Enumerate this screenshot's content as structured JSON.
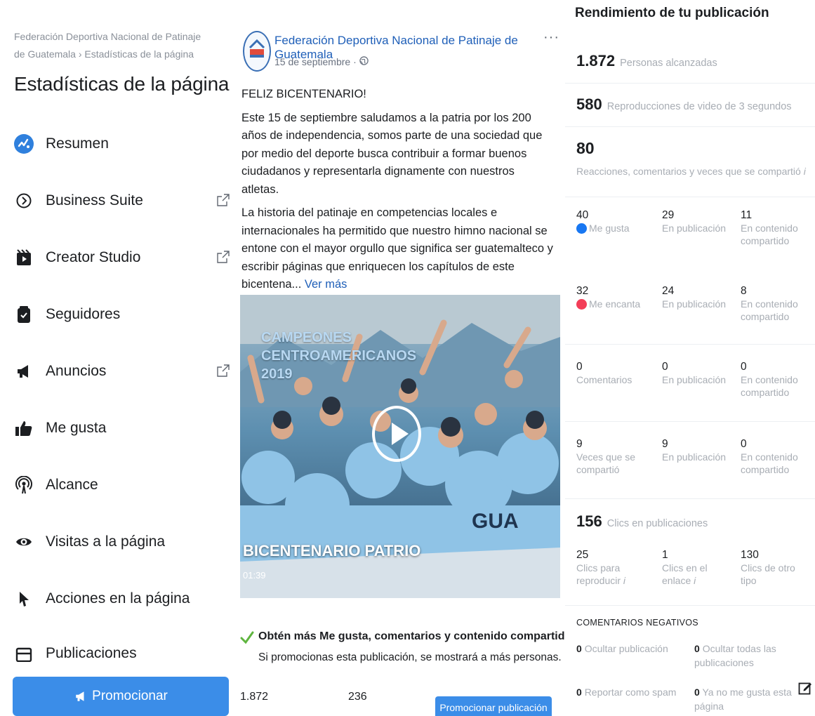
{
  "sidebar": {
    "breadcrumb": "Federación Deportiva Nacional de Patinaje de Guatemala › Estadísticas de la página",
    "title": "Estadísticas de la página",
    "items": [
      {
        "label": "Resumen",
        "icon": "summary-icon"
      },
      {
        "label": "Business Suite",
        "icon": "business-suite-icon"
      },
      {
        "label": "Creator Studio",
        "icon": "creator-studio-icon"
      },
      {
        "label": "Seguidores",
        "icon": "followers-icon"
      },
      {
        "label": "Anuncios",
        "icon": "megaphone-icon"
      },
      {
        "label": "Me gusta",
        "icon": "thumbs-up-icon"
      },
      {
        "label": "Alcance",
        "icon": "reach-icon"
      },
      {
        "label": "Visitas a la página",
        "icon": "eye-icon"
      },
      {
        "label": "Acciones en la página",
        "icon": "cursor-icon"
      },
      {
        "label": "Publicaciones",
        "icon": "posts-icon"
      }
    ],
    "promote_label": "Promocionar"
  },
  "post": {
    "author": "Federación Deportiva Nacional de Patinaje de Guatemala",
    "date": "15 de septiembre ·",
    "more": "···",
    "heading": "FELIZ BICENTENARIO!",
    "paragraph1": "Este 15 de septiembre saludamos a la patria por los 200 años de independencia, somos parte de una sociedad que por medio del deporte busca contribuir a formar buenos ciudadanos y representarla dignamente con nuestros atletas.",
    "paragraph2": "La historia del patinaje en competencias locales e internacionales ha permitido que nuestro himno nacional se entone con el mayor orgullo que significa ser guatemalteco y escribir páginas que enriquecen los capítulos de este bicentena...",
    "see_more": "Ver más",
    "video": {
      "overlay_title": "CAMPEONES CENTROAMERICANOS 2019",
      "title": "BICENTENARIO PATRIO",
      "duration": "01:39"
    },
    "promo_heading": "Obtén más Me gusta, comentarios y contenido compartido",
    "promo_sub": "Si promocionas esta publicación, se mostrará a más personas.",
    "reach": "1.872",
    "engagement": "236",
    "boost_label": "Promocionar publicación"
  },
  "performance": {
    "title": "Rendimiento de tu publicación",
    "people_reached": {
      "value": "1.872",
      "label": "Personas alcanzadas"
    },
    "video_views": {
      "value": "580",
      "label": "Reproducciones de video de 3 segundos"
    },
    "interactions": {
      "value": "80",
      "label": "Reacciones, comentarios y veces que se compartió"
    },
    "rows": [
      {
        "total": "40",
        "total_label": "Me gusta",
        "on_post": "29",
        "on_post_label": "En publicación",
        "shared": "11",
        "shared_label": "En contenido compartido"
      },
      {
        "total": "32",
        "total_label": "Me encanta",
        "on_post": "24",
        "on_post_label": "En publicación",
        "shared": "8",
        "shared_label": "En contenido compartido"
      },
      {
        "total": "0",
        "total_label": "Comentarios",
        "on_post": "0",
        "on_post_label": "En publicación",
        "shared": "0",
        "shared_label": "En contenido compartido"
      },
      {
        "total": "9",
        "total_label": "Veces que se compartió",
        "on_post": "9",
        "on_post_label": "En publicación",
        "shared": "0",
        "shared_label": "En contenido compartido"
      }
    ],
    "post_clicks": {
      "value": "156",
      "label": "Clics en publicaciones"
    },
    "clicks": [
      {
        "value": "25",
        "label": "Clics para reproducir"
      },
      {
        "value": "1",
        "label": "Clics en el enlace"
      },
      {
        "value": "130",
        "label": "Clics de otro tipo"
      }
    ],
    "negative_title": "COMENTARIOS NEGATIVOS",
    "negative": [
      {
        "value": "0",
        "label": "Ocultar publicación"
      },
      {
        "value": "0",
        "label": "Ocultar todas las publicaciones"
      },
      {
        "value": "0",
        "label": "Reportar como spam"
      },
      {
        "value": "0",
        "label": "Ya no me gusta esta página"
      }
    ],
    "colors": {
      "accent": "#3b8de8",
      "like": "#1877f2",
      "love": "#f33e58"
    }
  }
}
